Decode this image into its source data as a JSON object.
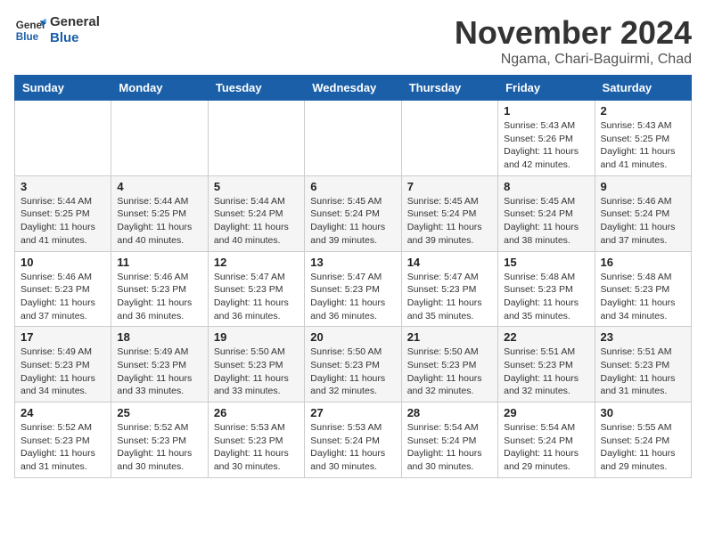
{
  "logo": {
    "line1": "General",
    "line2": "Blue"
  },
  "header": {
    "month": "November 2024",
    "location": "Ngama, Chari-Baguirmi, Chad"
  },
  "weekdays": [
    "Sunday",
    "Monday",
    "Tuesday",
    "Wednesday",
    "Thursday",
    "Friday",
    "Saturday"
  ],
  "weeks": [
    [
      {
        "day": "",
        "info": ""
      },
      {
        "day": "",
        "info": ""
      },
      {
        "day": "",
        "info": ""
      },
      {
        "day": "",
        "info": ""
      },
      {
        "day": "",
        "info": ""
      },
      {
        "day": "1",
        "info": "Sunrise: 5:43 AM\nSunset: 5:26 PM\nDaylight: 11 hours and 42 minutes."
      },
      {
        "day": "2",
        "info": "Sunrise: 5:43 AM\nSunset: 5:25 PM\nDaylight: 11 hours and 41 minutes."
      }
    ],
    [
      {
        "day": "3",
        "info": "Sunrise: 5:44 AM\nSunset: 5:25 PM\nDaylight: 11 hours and 41 minutes."
      },
      {
        "day": "4",
        "info": "Sunrise: 5:44 AM\nSunset: 5:25 PM\nDaylight: 11 hours and 40 minutes."
      },
      {
        "day": "5",
        "info": "Sunrise: 5:44 AM\nSunset: 5:24 PM\nDaylight: 11 hours and 40 minutes."
      },
      {
        "day": "6",
        "info": "Sunrise: 5:45 AM\nSunset: 5:24 PM\nDaylight: 11 hours and 39 minutes."
      },
      {
        "day": "7",
        "info": "Sunrise: 5:45 AM\nSunset: 5:24 PM\nDaylight: 11 hours and 39 minutes."
      },
      {
        "day": "8",
        "info": "Sunrise: 5:45 AM\nSunset: 5:24 PM\nDaylight: 11 hours and 38 minutes."
      },
      {
        "day": "9",
        "info": "Sunrise: 5:46 AM\nSunset: 5:24 PM\nDaylight: 11 hours and 37 minutes."
      }
    ],
    [
      {
        "day": "10",
        "info": "Sunrise: 5:46 AM\nSunset: 5:23 PM\nDaylight: 11 hours and 37 minutes."
      },
      {
        "day": "11",
        "info": "Sunrise: 5:46 AM\nSunset: 5:23 PM\nDaylight: 11 hours and 36 minutes."
      },
      {
        "day": "12",
        "info": "Sunrise: 5:47 AM\nSunset: 5:23 PM\nDaylight: 11 hours and 36 minutes."
      },
      {
        "day": "13",
        "info": "Sunrise: 5:47 AM\nSunset: 5:23 PM\nDaylight: 11 hours and 36 minutes."
      },
      {
        "day": "14",
        "info": "Sunrise: 5:47 AM\nSunset: 5:23 PM\nDaylight: 11 hours and 35 minutes."
      },
      {
        "day": "15",
        "info": "Sunrise: 5:48 AM\nSunset: 5:23 PM\nDaylight: 11 hours and 35 minutes."
      },
      {
        "day": "16",
        "info": "Sunrise: 5:48 AM\nSunset: 5:23 PM\nDaylight: 11 hours and 34 minutes."
      }
    ],
    [
      {
        "day": "17",
        "info": "Sunrise: 5:49 AM\nSunset: 5:23 PM\nDaylight: 11 hours and 34 minutes."
      },
      {
        "day": "18",
        "info": "Sunrise: 5:49 AM\nSunset: 5:23 PM\nDaylight: 11 hours and 33 minutes."
      },
      {
        "day": "19",
        "info": "Sunrise: 5:50 AM\nSunset: 5:23 PM\nDaylight: 11 hours and 33 minutes."
      },
      {
        "day": "20",
        "info": "Sunrise: 5:50 AM\nSunset: 5:23 PM\nDaylight: 11 hours and 32 minutes."
      },
      {
        "day": "21",
        "info": "Sunrise: 5:50 AM\nSunset: 5:23 PM\nDaylight: 11 hours and 32 minutes."
      },
      {
        "day": "22",
        "info": "Sunrise: 5:51 AM\nSunset: 5:23 PM\nDaylight: 11 hours and 32 minutes."
      },
      {
        "day": "23",
        "info": "Sunrise: 5:51 AM\nSunset: 5:23 PM\nDaylight: 11 hours and 31 minutes."
      }
    ],
    [
      {
        "day": "24",
        "info": "Sunrise: 5:52 AM\nSunset: 5:23 PM\nDaylight: 11 hours and 31 minutes."
      },
      {
        "day": "25",
        "info": "Sunrise: 5:52 AM\nSunset: 5:23 PM\nDaylight: 11 hours and 30 minutes."
      },
      {
        "day": "26",
        "info": "Sunrise: 5:53 AM\nSunset: 5:23 PM\nDaylight: 11 hours and 30 minutes."
      },
      {
        "day": "27",
        "info": "Sunrise: 5:53 AM\nSunset: 5:24 PM\nDaylight: 11 hours and 30 minutes."
      },
      {
        "day": "28",
        "info": "Sunrise: 5:54 AM\nSunset: 5:24 PM\nDaylight: 11 hours and 30 minutes."
      },
      {
        "day": "29",
        "info": "Sunrise: 5:54 AM\nSunset: 5:24 PM\nDaylight: 11 hours and 29 minutes."
      },
      {
        "day": "30",
        "info": "Sunrise: 5:55 AM\nSunset: 5:24 PM\nDaylight: 11 hours and 29 minutes."
      }
    ]
  ]
}
